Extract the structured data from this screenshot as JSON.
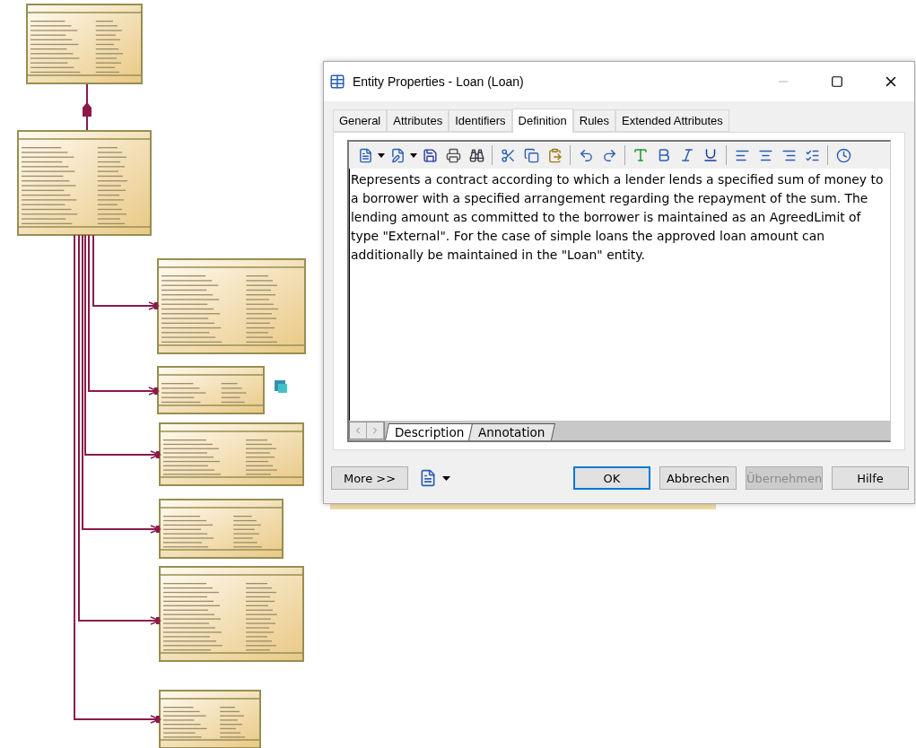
{
  "window": {
    "title": "Entity Properties - Loan (Loan)"
  },
  "tabs": [
    {
      "label": "General",
      "selected": false
    },
    {
      "label": "Attributes",
      "selected": false
    },
    {
      "label": "Identifiers",
      "selected": false
    },
    {
      "label": "Definition",
      "selected": true
    },
    {
      "label": "Rules",
      "selected": false
    },
    {
      "label": "Extended Attributes",
      "selected": false
    }
  ],
  "editor": {
    "text": "Represents a contract according to which a lender lends a specified sum of money to a borrower with a specified arrangement regarding the repayment of the sum. The lending amount as committed to the borrower is maintained as an AgreedLimit of type \"External\". For the case of simple loans the approved loan amount can additionally be maintained in the \"Loan\" entity.",
    "tabs": [
      {
        "label": "Description",
        "selected": true
      },
      {
        "label": "Annotation",
        "selected": false
      }
    ]
  },
  "buttons": [
    {
      "label": "More >>",
      "kind": "more",
      "default": false,
      "disabled": false
    },
    {
      "label": "OK",
      "kind": "action",
      "default": true,
      "disabled": false
    },
    {
      "label": "Abbrechen",
      "kind": "action",
      "default": false,
      "disabled": false
    },
    {
      "label": "Übernehmen",
      "kind": "action",
      "default": false,
      "disabled": true
    },
    {
      "label": "Hilfe",
      "kind": "action",
      "default": false,
      "disabled": false
    }
  ]
}
